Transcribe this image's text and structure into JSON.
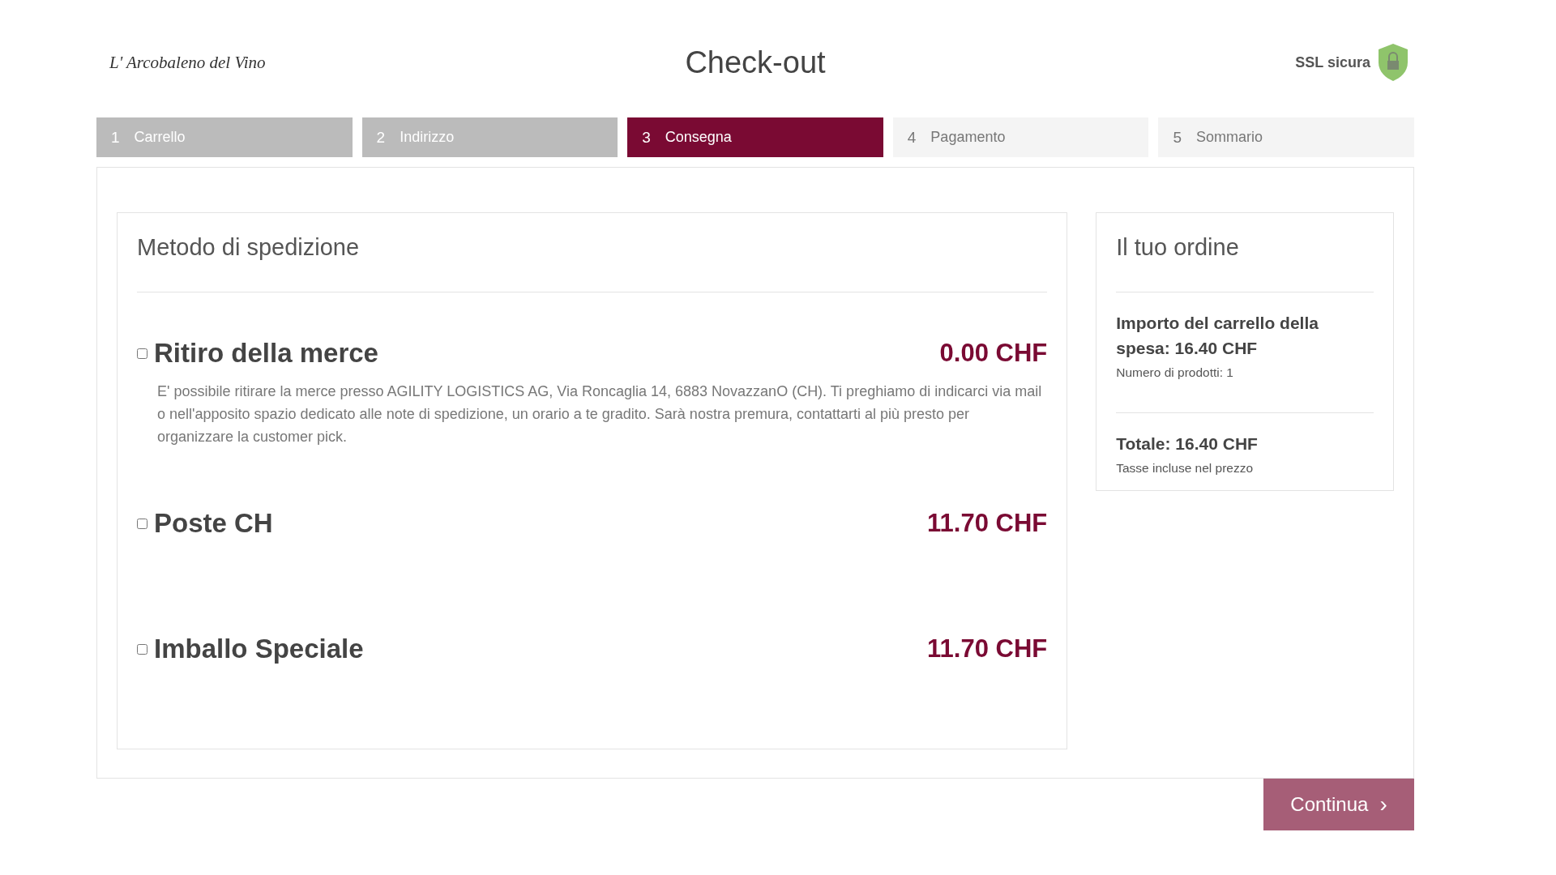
{
  "header": {
    "logo": "L' Arcobaleno del Vino",
    "title": "Check-out",
    "ssl_label": "SSL sicura"
  },
  "steps": [
    {
      "number": "1",
      "label": "Carrello",
      "completed": true,
      "selected": false
    },
    {
      "number": "2",
      "label": "Indirizzo",
      "completed": true,
      "selected": false
    },
    {
      "number": "3",
      "label": "Consegna",
      "selected": true
    },
    {
      "number": "4",
      "label": "Pagamento",
      "completed": false,
      "selected": false
    },
    {
      "number": "5",
      "label": "Sommario",
      "completed": false,
      "selected": false
    }
  ],
  "shipping": {
    "title": "Metodo di spedizione",
    "options": [
      {
        "name": "Ritiro della merce",
        "price": "0.00 CHF",
        "checked": false,
        "description": "E' possibile ritirare la merce presso AGILITY LOGISTICS AG, Via Roncaglia 14, 6883 NovazzanO (CH). Ti preghiamo di indicarci via mail o nell'apposito spazio dedicato alle note di spedizione, un orario a te gradito. Sarà nostra premura, contattarti al più presto per organizzare la customer pick."
      },
      {
        "name": "Poste CH",
        "price": "11.70 CHF",
        "checked": false
      },
      {
        "name": "Imballo Speciale",
        "price": "11.70 CHF",
        "checked": false
      }
    ]
  },
  "order": {
    "title": "Il tuo ordine",
    "cart_amount": "Importo del carrello della spesa: 16.40 CHF",
    "product_count": "Numero di prodotti: 1",
    "total": "Totale: 16.40 CHF",
    "tax_note": "Tasse incluse nel prezzo"
  },
  "continue_button": {
    "label": "Continua",
    "icon": "›"
  }
}
